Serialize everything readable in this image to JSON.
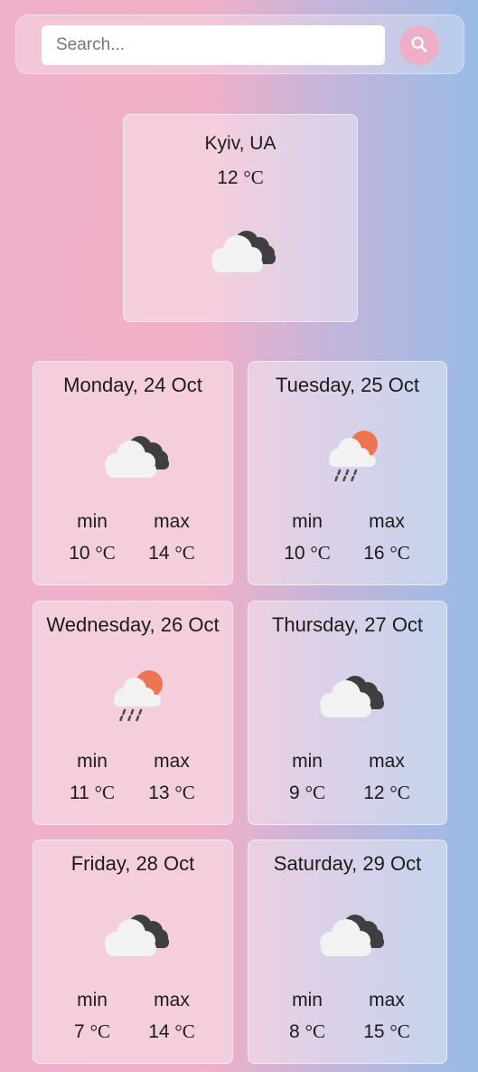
{
  "search": {
    "placeholder": "Search..."
  },
  "current": {
    "location": "Kyiv, UA",
    "temp": "12",
    "unit": "°C",
    "icon": "cloudy-icon"
  },
  "labels": {
    "min": "min",
    "max": "max"
  },
  "days": [
    {
      "title": "Monday, 24 Oct",
      "icon": "cloudy-icon",
      "min": "10",
      "max": "14"
    },
    {
      "title": "Tuesday, 25 Oct",
      "icon": "sun-rain-icon",
      "min": "10",
      "max": "16"
    },
    {
      "title": "Wednesday, 26 Oct",
      "icon": "sun-rain-icon",
      "min": "11",
      "max": "13"
    },
    {
      "title": "Thursday, 27 Oct",
      "icon": "cloudy-icon",
      "min": "9",
      "max": "12"
    },
    {
      "title": "Friday, 28 Oct",
      "icon": "cloudy-icon",
      "min": "7",
      "max": "14"
    },
    {
      "title": "Saturday, 29 Oct",
      "icon": "cloudy-icon",
      "min": "8",
      "max": "15"
    }
  ],
  "colors": {
    "accent": "#efaec7",
    "cloud": "#f2f2f2",
    "dark_cloud": "#3f3f41",
    "sun": "#ee7551"
  }
}
